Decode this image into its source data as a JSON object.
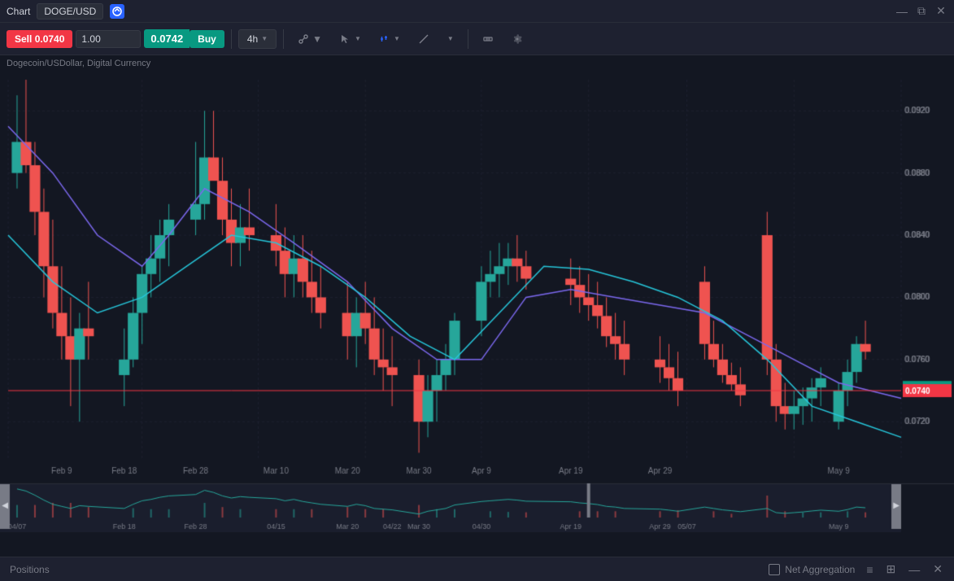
{
  "titlebar": {
    "label": "Chart",
    "symbol": "DOGE/USD",
    "icon_label": "D"
  },
  "toolbar": {
    "sell_label": "Sell",
    "sell_price": "0.0740",
    "buy_price": "0.0742",
    "buy_label": "Buy",
    "qty_value": "1.00",
    "qty_placeholder": "1.00",
    "timeframe": "4h",
    "timeframe_caret": "▼"
  },
  "chart_header": {
    "subtitle": "Dogecoin/USDollar, Digital Currency"
  },
  "price_labels": {
    "current_green": "0.0742",
    "current_red": "0.0740"
  },
  "bottom_bar": {
    "positions_label": "Positions",
    "net_aggregation_label": "Net Aggregation"
  },
  "x_axis_labels": [
    "Feb 9",
    "Feb 18",
    "Feb 28",
    "Mar 10",
    "Mar 20",
    "Mar 30",
    "Apr 9",
    "Apr 19",
    "Apr 29",
    "May 9"
  ],
  "y_axis_labels": [
    "0.0920",
    "0.0880",
    "0.0840",
    "0.0800",
    "0.0760",
    "0.0720"
  ],
  "mini_labels": [
    "04/07",
    "Feb 18",
    "Feb 28",
    "04/15",
    "Mar 20",
    "04/22",
    "Mar 30",
    "04/30",
    "Apr 19",
    "05/07",
    "Apr 29",
    "May 9"
  ]
}
